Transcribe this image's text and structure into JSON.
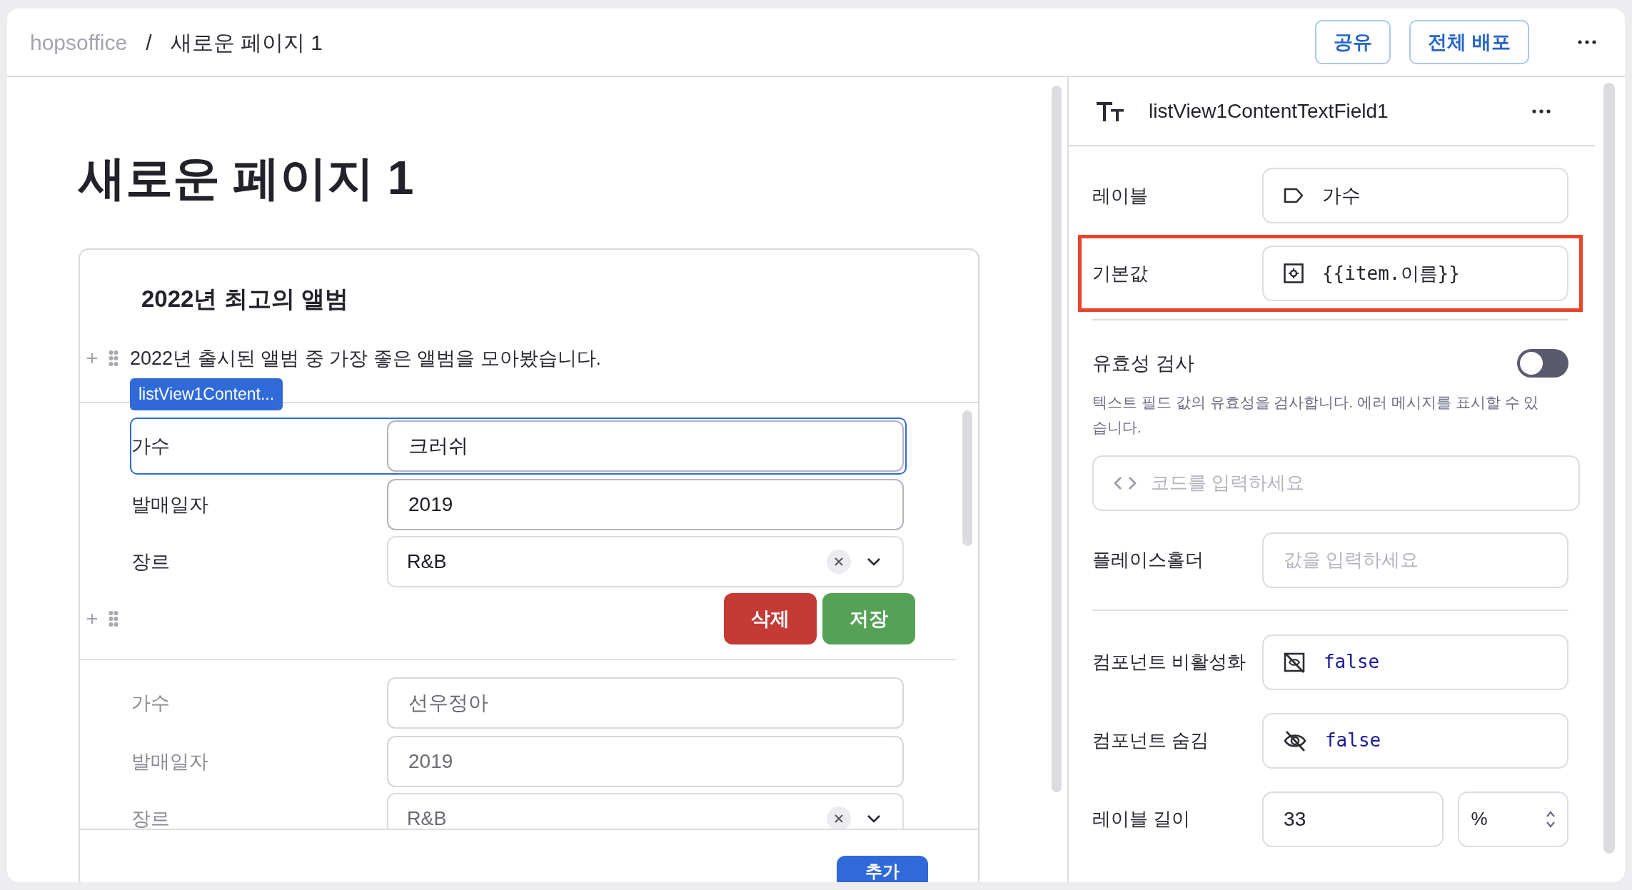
{
  "breadcrumb": {
    "workspace": "hopsoffice",
    "separator": "/",
    "page": "새로운 페이지 1"
  },
  "header_buttons": [
    "공유",
    "전체 배포"
  ],
  "page_title": "새로운 페이지 1",
  "card": {
    "title": "2022년 최고의 앨범",
    "description": "2022년 출시된 앨범 중 가장 좋은 앨범을 모아봤습니다.",
    "selection_tag": "listView1Content...",
    "items": [
      {
        "selected": true,
        "fields": [
          {
            "kind": "text",
            "label": "가수",
            "value": "크러쉬"
          },
          {
            "kind": "text",
            "label": "발매일자",
            "value": "2019"
          },
          {
            "kind": "select",
            "label": "장르",
            "value": "R&B"
          }
        ],
        "actions": [
          {
            "kind": "danger",
            "label": "삭제"
          },
          {
            "kind": "success",
            "label": "저장"
          }
        ]
      },
      {
        "selected": false,
        "fields": [
          {
            "kind": "text",
            "label": "가수",
            "value": "선우정아"
          },
          {
            "kind": "text",
            "label": "발매일자",
            "value": "2019"
          },
          {
            "kind": "select",
            "label": "장르",
            "value": "R&B"
          }
        ]
      }
    ],
    "add_button": "추가"
  },
  "inspector": {
    "title": "listView1ContentTextField1",
    "label_field": {
      "label": "레이블",
      "value": "가수"
    },
    "default_value": {
      "label": "기본값",
      "value": "{{item.이름}}",
      "highlighted": true
    },
    "validation": {
      "label": "유효성 검사",
      "on": false,
      "description": "텍스트 필드 값의 유효성을 검사합니다. 에러 메시지를 표시할 수 있습니다.",
      "code_placeholder": "코드를 입력하세요"
    },
    "placeholder_field": {
      "label": "플레이스홀더",
      "placeholder": "값을 입력하세요"
    },
    "disabled_field": {
      "label": "컴포넌트 비활성화",
      "value": "false"
    },
    "hidden_field": {
      "label": "컴포넌트 숨김",
      "value": "false"
    },
    "label_width": {
      "label": "레이블 길이",
      "value": "33",
      "unit": "%"
    }
  }
}
